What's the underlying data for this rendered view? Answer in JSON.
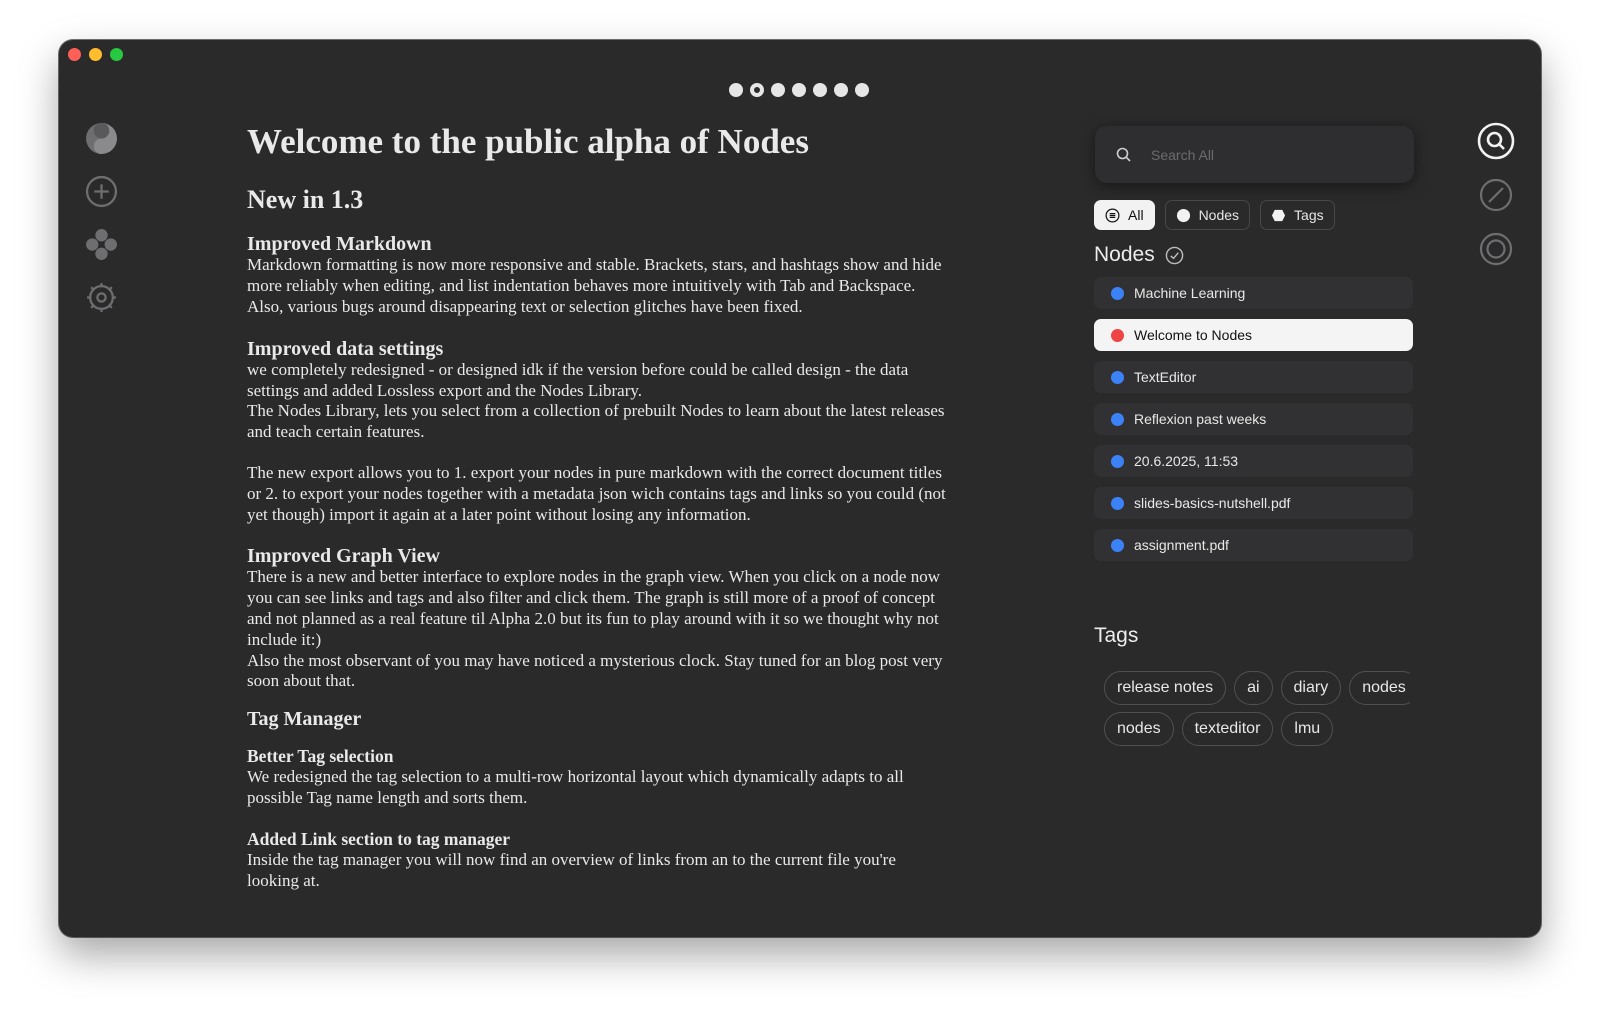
{
  "search": {
    "placeholder": "Search All"
  },
  "filters": [
    {
      "label": "All",
      "icon": "list-circle-icon",
      "active": true
    },
    {
      "label": "Nodes",
      "icon": "circle-icon",
      "active": false
    },
    {
      "label": "Tags",
      "icon": "tag-icon",
      "active": false
    }
  ],
  "nodes_section": {
    "title": "Nodes",
    "items": [
      {
        "label": "Machine Learning",
        "color": "#3b82f6"
      },
      {
        "label": "Welcome to Nodes",
        "color": "#ef4444",
        "selected": true
      },
      {
        "label": "TextEditor",
        "color": "#3b82f6"
      },
      {
        "label": "Reflexion past weeks",
        "color": "#3b82f6"
      },
      {
        "label": "20.6.2025, 11:53",
        "color": "#3b82f6"
      },
      {
        "label": "slides-basics-nutshell.pdf",
        "color": "#3b82f6"
      },
      {
        "label": "assignment.pdf",
        "color": "#3b82f6"
      }
    ]
  },
  "tags_section": {
    "title": "Tags",
    "row1": [
      "release notes",
      "ai",
      "diary",
      "nodes"
    ],
    "row2": [
      "nodes",
      "texteditor",
      "lmu"
    ]
  },
  "document": {
    "title": "Welcome to the public alpha of Nodes",
    "subtitle": "New in 1.3",
    "sec1_heading": "Improved Markdown",
    "sec1_body": "Markdown formatting is now more responsive and stable. Brackets, stars, and hashtags show and hide more reliably when editing, and list indentation behaves more intuitively with Tab and Backspace. Also, various bugs around disappearing text or selection glitches have been fixed.",
    "sec2_heading": "Improved data settings",
    "sec2_body1": "we completely redesigned - or designed idk if the version before could be called design - the data settings and added Lossless export and the Nodes Library.",
    "sec2_body2": "The Nodes Library, lets you select from a collection of prebuilt Nodes to learn about the latest releases and teach certain features.",
    "sec2_body3": "The new export allows you to 1. export your nodes in pure markdown with the correct document titles or 2. to export your nodes together with a metadata json wich contains tags and links so you could (not yet though) import it again at a later point without losing any information.",
    "sec3_heading": "Improved Graph View",
    "sec3_body1": "There is a new and better interface to explore nodes in the graph view. When you click on a node now you can see links and tags and also filter and click them. The graph is still more of a proof of concept and not planned as a real feature til Alpha 2.0 but its fun to play around with it so we thought why not include it:)",
    "sec3_body2": "Also the most observant of you may have noticed a mysterious clock. Stay tuned for an blog post very soon about that.",
    "sec4_heading": "Tag Manager",
    "sec4_sub1": "Better Tag selection",
    "sec4_sub1_body": "We redesigned the tag selection to a multi-row horizontal layout which dynamically adapts to all possible Tag name length and sorts them.",
    "sec4_sub2": "Added Link section to tag manager",
    "sec4_sub2_body": "Inside the tag manager you will now find an overview of links from an to the current file you're looking at."
  },
  "page_indicator": {
    "count": 7,
    "active": 2
  },
  "icons": {
    "left": [
      "yin-yang-icon",
      "add-circle-icon",
      "nodes-cluster-icon",
      "settings-gear-icon"
    ],
    "right": [
      "search-circle-icon",
      "edit-circle-icon",
      "target-circle-icon"
    ]
  }
}
